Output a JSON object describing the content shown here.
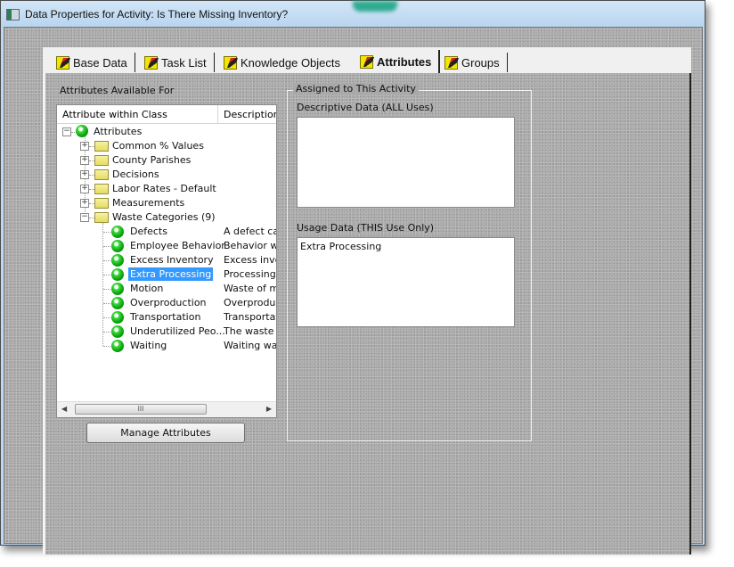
{
  "window": {
    "title": "Data Properties for Activity: Is There Missing Inventory?"
  },
  "tabs": [
    {
      "label": "Base Data",
      "active": false
    },
    {
      "label": "Task List",
      "active": false
    },
    {
      "label": "Knowledge Objects",
      "active": false
    },
    {
      "label": "Attributes",
      "active": true
    },
    {
      "label": "Groups",
      "active": false
    }
  ],
  "left": {
    "section_label": "Attributes Available For",
    "columns": [
      "Attribute within Class",
      "Description"
    ],
    "tree": {
      "root": "Attributes",
      "folders": [
        {
          "label": "Common % Values",
          "expanded": false
        },
        {
          "label": "County Parishes",
          "expanded": false
        },
        {
          "label": "Decisions",
          "expanded": false
        },
        {
          "label": "Labor Rates - Default",
          "expanded": false
        },
        {
          "label": "Measurements",
          "expanded": false
        },
        {
          "label": "Waste Categories (9)",
          "expanded": true
        }
      ],
      "items": [
        {
          "label": "Defects",
          "description": "A defect ca."
        },
        {
          "label": "Employee Behavior",
          "description": "Behavior wa"
        },
        {
          "label": "Excess Inventory",
          "description": "Excess inve"
        },
        {
          "label": "Extra Processing",
          "description": "Processing .",
          "selected": true
        },
        {
          "label": "Motion",
          "description": "Waste of mo"
        },
        {
          "label": "Overproduction",
          "description": "Overproduct"
        },
        {
          "label": "Transportation",
          "description": "Transportati."
        },
        {
          "label": "Underutilized Peo...",
          "description": "The waste o"
        },
        {
          "label": "Waiting",
          "description": "Waiting was"
        }
      ]
    },
    "scroll_thumb_glyph": "III",
    "manage_button": "Manage Attributes"
  },
  "right": {
    "group_title": "Assigned to This Activity",
    "descriptive_label": "Descriptive Data (ALL Uses)",
    "descriptive_value": "",
    "usage_label": "Usage Data (THIS Use Only)",
    "usage_value": "Extra Processing"
  }
}
